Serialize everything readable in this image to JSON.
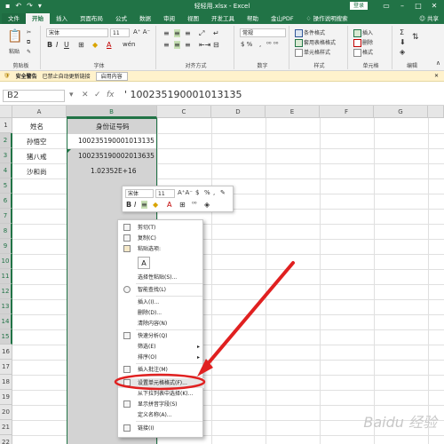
{
  "titlebar": {
    "title": "轻轻用.xlsx - Excel",
    "login": "登录",
    "qa_icons": [
      "save-icon",
      "undo-icon",
      "redo-icon",
      "customize-icon"
    ]
  },
  "tabs": [
    "文件",
    "开始",
    "插入",
    "页面布局",
    "公式",
    "数据",
    "审阅",
    "视图",
    "开发工具",
    "帮助",
    "金山PDF",
    "操作说明搜索"
  ],
  "share": "共享",
  "ribbon": {
    "paste": "粘贴",
    "clipboard": "剪贴板",
    "font_name": "宋体",
    "font_size": "11",
    "font_group": "字体",
    "align_group": "对齐方式",
    "number_format": "常规",
    "number_group": "数字",
    "cond_format": "条件格式",
    "table_format": "套用表格格式",
    "cell_style": "单元格样式",
    "style_group": "样式",
    "insert": "插入",
    "delete": "删除",
    "format": "格式",
    "cells_group": "单元格",
    "edit_group": "编辑"
  },
  "warning": {
    "label": "安全警告",
    "text": "已禁止自动更新链接",
    "button": "启用内容"
  },
  "formula_bar": {
    "name_box": "B2",
    "fx": "fx",
    "formula": "' 100235190001013135"
  },
  "sheet": {
    "columns": [
      "A",
      "B",
      "C",
      "D",
      "E",
      "F",
      "G"
    ],
    "rows": [
      "1",
      "2",
      "3",
      "4",
      "5",
      "6",
      "7",
      "8",
      "9",
      "10",
      "11",
      "12",
      "13",
      "14",
      "15",
      "16",
      "17",
      "18",
      "19",
      "20",
      "21",
      "22"
    ],
    "header_name": "姓名",
    "header_id": "身份证号码",
    "names": [
      "孙悟空",
      "猪八戒",
      "沙和尚"
    ],
    "ids": [
      "100235190001013135",
      "100235190002013635",
      "1.02352E+16"
    ]
  },
  "minibar": {
    "font_name": "宋体",
    "font_size": "11"
  },
  "context_menu": {
    "items": [
      "剪切(T)",
      "复制(C)",
      "粘贴选项:",
      "选择性粘贴(S)...",
      "智能查找(L)",
      "插入(I)...",
      "删除(D)...",
      "清除内容(N)",
      "快速分析(Q)",
      "筛选(E)",
      "排序(O)",
      "插入批注(M)",
      "设置单元格格式(F)...",
      "从下拉列表中选择(K)...",
      "显示拼音字段(S)",
      "定义名称(A)...",
      "链接(I)"
    ]
  },
  "watermark": "Baidu 经验",
  "colors": {
    "excel_green": "#217346",
    "annotation_red": "#e02020"
  }
}
